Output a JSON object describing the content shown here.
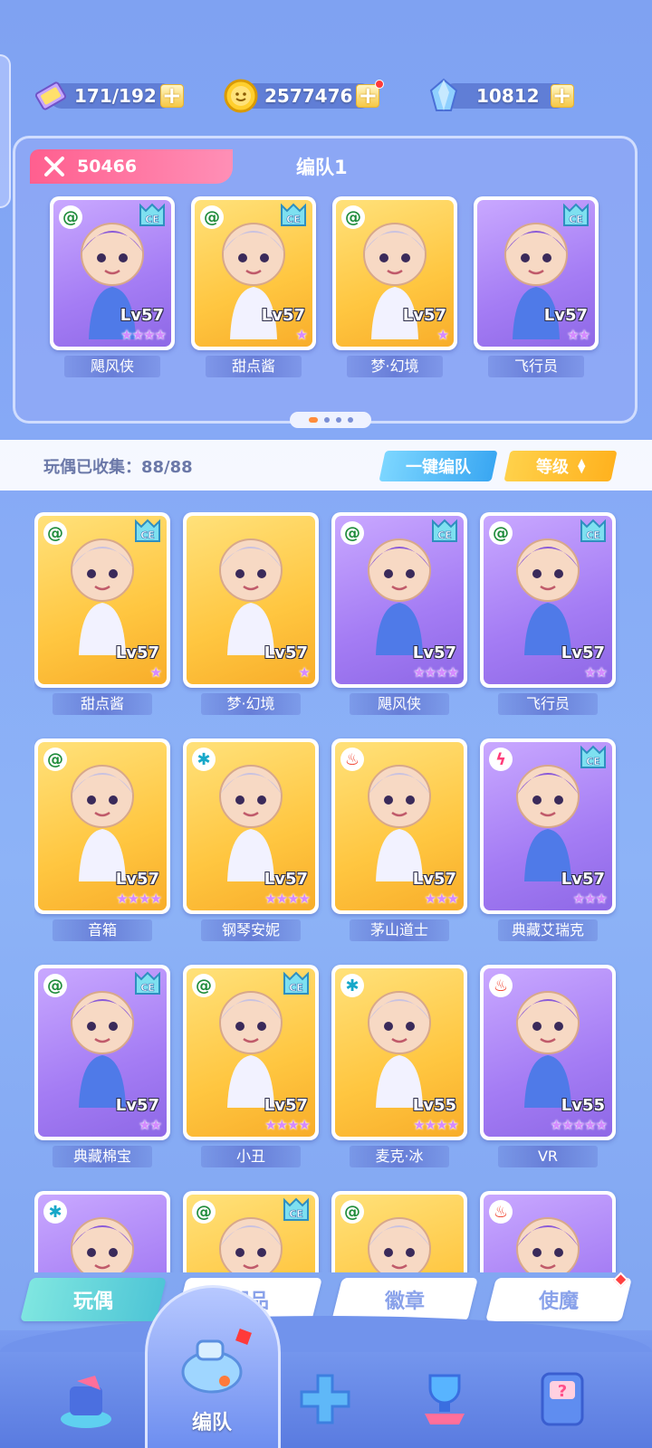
{
  "resources": {
    "stamina": "171/192",
    "coins": "2577476",
    "gems": "10812",
    "plus": "+"
  },
  "team": {
    "power": "50466",
    "title": "编队1",
    "members": [
      {
        "name": "飓风侠",
        "level": "Lv57",
        "stars": "★★★★",
        "element": "wind",
        "art": "purple",
        "ce": true
      },
      {
        "name": "甜点酱",
        "level": "Lv57",
        "stars": "★",
        "element": "wind",
        "art": "gold",
        "ce": true
      },
      {
        "name": "梦·幻境",
        "level": "Lv57",
        "stars": "★",
        "element": "wind",
        "art": "gold",
        "ce": false
      },
      {
        "name": "飞行员",
        "level": "Lv57",
        "stars": "★★",
        "element": "none",
        "art": "purple",
        "ce": true
      }
    ]
  },
  "collection": {
    "label": "玩偶已收集：88/88",
    "one_click_team": "一键编队",
    "sort_label": "等级"
  },
  "grid": [
    {
      "name": "甜点酱",
      "level": "Lv57",
      "stars": "★",
      "element": "wind",
      "art": "gold",
      "ce": true
    },
    {
      "name": "梦·幻境",
      "level": "Lv57",
      "stars": "★",
      "element": "none",
      "art": "gold",
      "ce": false
    },
    {
      "name": "飓风侠",
      "level": "Lv57",
      "stars": "★★★★",
      "element": "wind",
      "art": "purple",
      "ce": true
    },
    {
      "name": "飞行员",
      "level": "Lv57",
      "stars": "★★",
      "element": "wind",
      "art": "purple",
      "ce": true
    },
    {
      "name": "音箱",
      "level": "Lv57",
      "stars": "★★★★",
      "element": "wind",
      "art": "gold",
      "ce": false
    },
    {
      "name": "钢琴安妮",
      "level": "Lv57",
      "stars": "★★★★",
      "element": "water",
      "art": "gold",
      "ce": false
    },
    {
      "name": "茅山道士",
      "level": "Lv57",
      "stars": "★★★",
      "element": "fire",
      "art": "gold",
      "ce": false
    },
    {
      "name": "典藏艾瑞克",
      "level": "Lv57",
      "stars": "★★★",
      "element": "bolt",
      "art": "purple",
      "ce": true
    },
    {
      "name": "典藏棉宝",
      "level": "Lv57",
      "stars": "★★",
      "element": "wind",
      "art": "purple",
      "ce": true
    },
    {
      "name": "小丑",
      "level": "Lv57",
      "stars": "★★★★",
      "element": "wind",
      "art": "gold",
      "ce": true
    },
    {
      "name": "麦克·冰",
      "level": "Lv55",
      "stars": "★★★★",
      "element": "water",
      "art": "gold",
      "ce": false
    },
    {
      "name": "VR",
      "level": "Lv55",
      "stars": "★★★★★",
      "element": "fire",
      "art": "purple",
      "ce": false
    },
    {
      "name": "",
      "level": "",
      "stars": "",
      "element": "water",
      "art": "purple",
      "ce": false
    },
    {
      "name": "",
      "level": "",
      "stars": "",
      "element": "wind",
      "art": "gold",
      "ce": true
    },
    {
      "name": "",
      "level": "",
      "stars": "",
      "element": "wind",
      "art": "gold",
      "ce": false
    },
    {
      "name": "",
      "level": "",
      "stars": "",
      "element": "fire",
      "art": "purple",
      "ce": false
    }
  ],
  "categories": [
    {
      "label": "玩偶",
      "active": true
    },
    {
      "label": "潮品",
      "active": false
    },
    {
      "label": "徽章",
      "active": false
    },
    {
      "label": "使魔",
      "active": false
    }
  ],
  "nav": {
    "center_label": "编队"
  },
  "colors": {
    "accent_pink": "#ff5f8f",
    "accent_blue": "#3aa7f2",
    "accent_yellow": "#ffb21f",
    "active_tab": "#4ec5d6"
  }
}
